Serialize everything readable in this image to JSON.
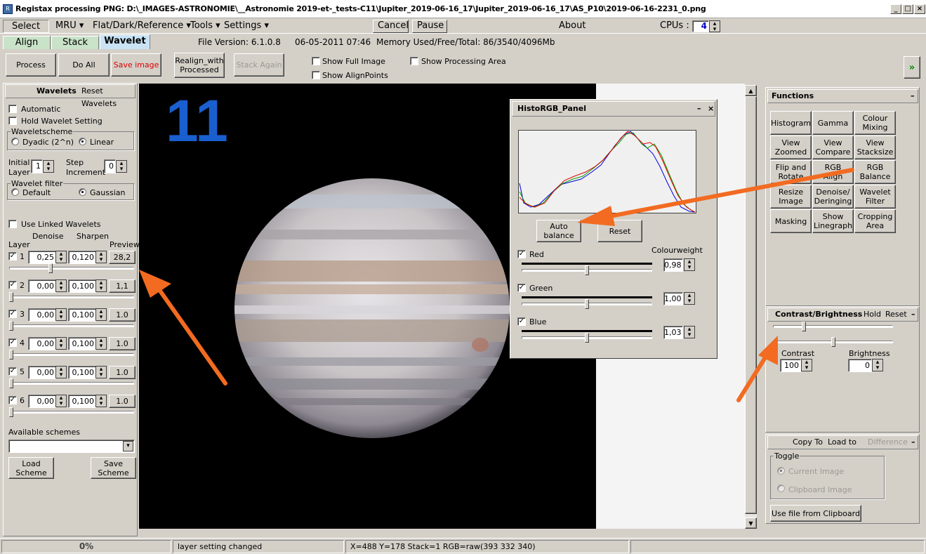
{
  "window": {
    "title": "Registax processing PNG: D:\\_IMAGES-ASTRONOMIE\\__Astronomie 2019-et-_tests-C11\\Jupiter_2019-06-16_17\\Jupiter_2019-06-16_17\\AS_P10\\2019-06-16-2231_0.png"
  },
  "menu": {
    "select": "Select",
    "mru": "MRU ▾",
    "flat": "Flat/Dark/Reference ▾",
    "tools": "Tools ▾",
    "settings": "Settings ▾",
    "cancel": "Cancel",
    "pause": "Pause",
    "about": "About",
    "cpus_label": "CPUs :",
    "cpus_value": "4"
  },
  "tabs": {
    "align": "Align",
    "stack": "Stack",
    "wavelet": "Wavelet",
    "file_version": "File Version: 6.1.0.8",
    "date": "06-05-2011 07:46",
    "memory": "Memory Used/Free/Total: 86/3540/4096Mb"
  },
  "toolbar": {
    "process": "Process",
    "do_all": "Do All",
    "save_image": "Save image",
    "realign_1": "Realign_with",
    "realign_2": "Processed",
    "stack_again": "Stack Again",
    "show_full": "Show Full Image",
    "show_align": "Show AlignPoints",
    "show_area": "Show Processing Area",
    "more": "»"
  },
  "wavelets": {
    "header": "Wavelets",
    "reset": "Reset Wavelets",
    "automatic": "Automatic",
    "hold": "Hold Wavelet Setting",
    "scheme_label": "Waveletscheme",
    "dyadic": "Dyadic (2^n)",
    "linear": "Linear",
    "initial_1": "Initial",
    "initial_2": "Layer",
    "initial_value": "1",
    "step_1": "Step",
    "step_2": "Increment",
    "step_value": "0",
    "filter_label": "Wavelet filter",
    "default": "Default",
    "gaussian": "Gaussian",
    "use_linked": "Use Linked Wavelets",
    "col_denoise": "Denoise",
    "col_sharpen": "Sharpen",
    "col_layer": "Layer",
    "col_preview": "Preview",
    "layers": [
      {
        "n": "1",
        "denoise": "0,25",
        "sharpen": "0,120",
        "preview": "28,2",
        "slider": 0.33
      },
      {
        "n": "2",
        "denoise": "0,00",
        "sharpen": "0,100",
        "preview": "1,1",
        "slider": 0.0
      },
      {
        "n": "3",
        "denoise": "0,00",
        "sharpen": "0,100",
        "preview": "1.0",
        "slider": 0.0
      },
      {
        "n": "4",
        "denoise": "0,00",
        "sharpen": "0,100",
        "preview": "1.0",
        "slider": 0.0
      },
      {
        "n": "5",
        "denoise": "0,00",
        "sharpen": "0,100",
        "preview": "1.0",
        "slider": 0.0
      },
      {
        "n": "6",
        "denoise": "0,00",
        "sharpen": "0,100",
        "preview": "1.0",
        "slider": 0.0
      }
    ],
    "available": "Available schemes",
    "load_1": "Load",
    "load_2": "Scheme",
    "save_1": "Save",
    "save_2": "Scheme"
  },
  "image": {
    "overlay_number": "11",
    "overlay_color": "#1a5fd0"
  },
  "histo": {
    "title": "HistoRGB_Panel",
    "auto_1": "Auto",
    "auto_2": "balance",
    "reset": "Reset",
    "colourweight": "Colourweight",
    "channels": [
      {
        "name": "Red",
        "value": "0,98",
        "color": "#e00000"
      },
      {
        "name": "Green",
        "value": "1,00",
        "color": "#00a000"
      },
      {
        "name": "Blue",
        "value": "1,03",
        "color": "#0000e0"
      }
    ]
  },
  "functions": {
    "header": "Functions",
    "buttons": [
      [
        "Histogram",
        ""
      ],
      [
        "Gamma",
        ""
      ],
      [
        "Colour",
        "Mixing"
      ],
      [
        "View",
        "Zoomed"
      ],
      [
        "View",
        "Compare"
      ],
      [
        "View",
        "Stacksize"
      ],
      [
        "Flip and",
        "Rotate"
      ],
      [
        "RGB",
        "Align"
      ],
      [
        "RGB",
        "Balance"
      ],
      [
        "Resize",
        "Image"
      ],
      [
        "Denoise/",
        "Deringing"
      ],
      [
        "Wavelet",
        "Filter"
      ],
      [
        "Masking",
        ""
      ],
      [
        "Show",
        "Linegraph"
      ],
      [
        "Cropping",
        "Area"
      ]
    ]
  },
  "contrast": {
    "header": "Contrast/Brightness",
    "hold": "Hold",
    "reset": "Reset",
    "contrast": "Contrast",
    "brightness": "Brightness",
    "contrast_value": "100",
    "brightness_value": "0"
  },
  "copyto": {
    "copy": "Copy To",
    "load": "Load to",
    "difference": "Difference",
    "toggle": "Toggle",
    "current": "Current Image",
    "clipboard": "Clipboard Image",
    "use_clip": "Use file from Clipboard"
  },
  "status": {
    "progress": "0%",
    "message": "layer setting changed",
    "coords": "X=488 Y=178 Stack=1 RGB=raw(393 332 340)"
  },
  "colors": {
    "arrow": "#f26b21",
    "progress_green": "#c8f0c8"
  }
}
